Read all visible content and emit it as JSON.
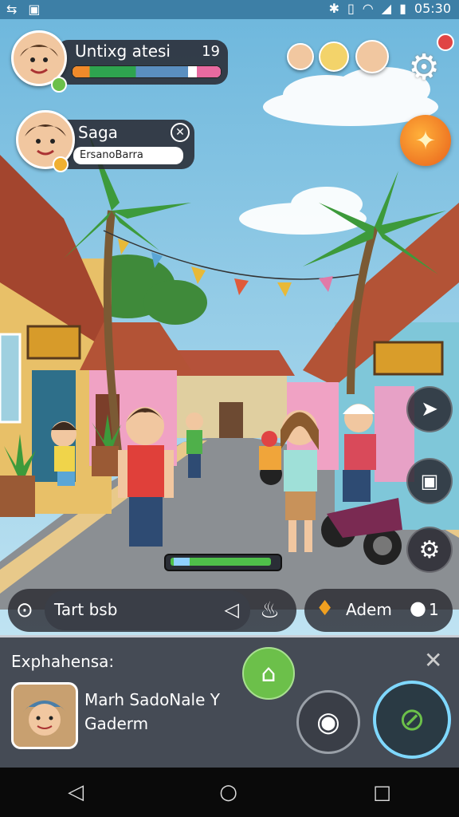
{
  "status_bar": {
    "time": "05:30"
  },
  "player": {
    "name": "Untixg atesi",
    "level": "19",
    "hp": 0.78
  },
  "chat_notification": {
    "name": "Saga",
    "message": "ErsanoBarra"
  },
  "search_bar": {
    "text": "Tart bsb"
  },
  "location_chip": {
    "label": "Adem",
    "count": "1"
  },
  "expansion_panel": {
    "title": "Exphahensa:",
    "item_line1": "Marh SadoNale Y",
    "item_line2": "Gaderm"
  },
  "colors": {
    "accent_green": "#6cc04a",
    "hp_bar": "#2ea44f",
    "panel": "#454b55"
  },
  "icons": [
    "battery-icon",
    "wifi-icon",
    "signal-icon",
    "gear-icon",
    "fire-icon",
    "paper-plane-icon",
    "robot-icon",
    "search-icon",
    "horn-icon",
    "genie-lamp-icon",
    "chat-icon",
    "close-icon",
    "home-icon",
    "camera-icon",
    "map-icon",
    "back-icon",
    "home-nav-icon",
    "recents-icon"
  ]
}
